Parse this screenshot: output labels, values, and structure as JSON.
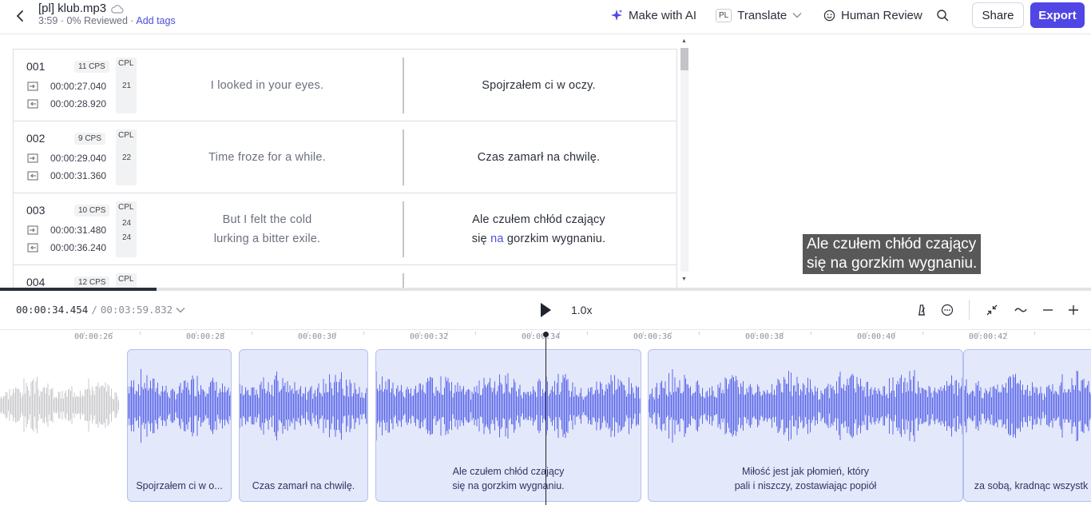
{
  "header": {
    "file_name": "[pl] klub.mp3",
    "duration": "3:59",
    "reviewed": "0% Reviewed",
    "separator": "·",
    "add_tags": "Add tags",
    "make_with_ai": "Make with AI",
    "translate_badge": "PL",
    "translate": "Translate",
    "human_review": "Human Review",
    "share": "Share",
    "export": "Export"
  },
  "colors": {
    "accent": "#4f46e5",
    "link": "#4a4fd8",
    "clip_fill": "#e4e8fb",
    "waveform_active": "#5b68e8",
    "waveform_inactive": "#c8c8cc"
  },
  "subtitles": [
    {
      "num": "001",
      "cps": "11 CPS",
      "cpl_label": "CPL",
      "cpl": [
        "21"
      ],
      "in": "00:00:27.040",
      "out": "00:00:28.920",
      "source": [
        "I looked in your eyes."
      ],
      "target": [
        "Spojrzałem ci w oczy."
      ]
    },
    {
      "num": "002",
      "cps": "9 CPS",
      "cpl_label": "CPL",
      "cpl": [
        "22"
      ],
      "in": "00:00:29.040",
      "out": "00:00:31.360",
      "source": [
        "Time froze for a while."
      ],
      "target": [
        "Czas zamarł na chwilę."
      ]
    },
    {
      "num": "003",
      "cps": "10 CPS",
      "cpl_label": "CPL",
      "cpl": [
        "24",
        "24"
      ],
      "in": "00:00:31.480",
      "out": "00:00:36.240",
      "source": [
        "But I felt the cold",
        "lurking a bitter exile."
      ],
      "target": [
        "Ale czułem chłód czający",
        "się ",
        "na",
        " gorzkim wygnaniu."
      ]
    },
    {
      "num": "004",
      "cps": "12 CPS",
      "cpl_label": "CPL",
      "cpl": [],
      "in": "",
      "out": "",
      "source": [],
      "target": []
    }
  ],
  "video_caption": [
    "Ale czułem chłód czający",
    "się na gorzkim wygnaniu."
  ],
  "player": {
    "current_time": "00:00:34.454",
    "slash": "/",
    "total_time": "00:03:59.832",
    "speed": "1.0x",
    "progress_fraction": 0.1437
  },
  "ruler_ticks": [
    "00:00:26",
    "00:00:28",
    "00:00:30",
    "00:00:32",
    "00:00:34",
    "00:00:36",
    "00:00:38",
    "00:00:40",
    "00:00:42"
  ],
  "clips": [
    {
      "text": [
        "Spojrzałem ci w o..."
      ]
    },
    {
      "text": [
        "Czas zamarł na chwilę."
      ]
    },
    {
      "text": [
        "Ale czułem chłód czający",
        "się na gorzkim wygnaniu."
      ]
    },
    {
      "text": [
        "Miłość jest jak płomień, który",
        "pali i niszczy, zostawiając popiół"
      ]
    },
    {
      "text": [
        "za sobą, kradnąc wszystk"
      ]
    }
  ]
}
